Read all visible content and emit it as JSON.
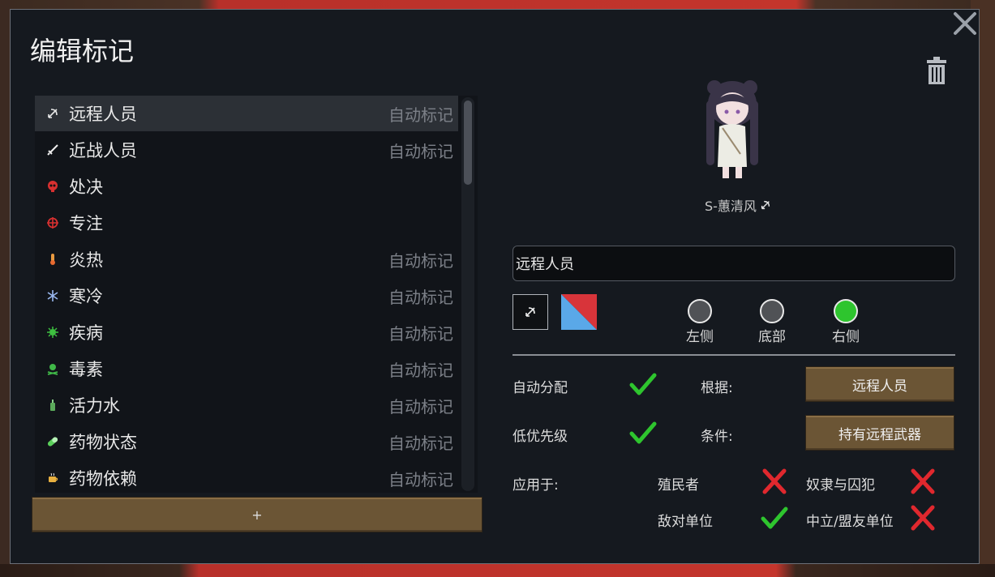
{
  "dialog": {
    "title": "编辑标记",
    "add_label": "+"
  },
  "list": {
    "items": [
      {
        "label": "远程人员",
        "tag": "自动标记",
        "icon": "bow-icon",
        "selected": true
      },
      {
        "label": "近战人员",
        "tag": "自动标记",
        "icon": "sword-icon"
      },
      {
        "label": "处决",
        "tag": "",
        "icon": "skull-icon"
      },
      {
        "label": "专注",
        "tag": "",
        "icon": "crosshair-icon"
      },
      {
        "label": "炎热",
        "tag": "自动标记",
        "icon": "thermometer-icon"
      },
      {
        "label": "寒冷",
        "tag": "自动标记",
        "icon": "snowflake-icon"
      },
      {
        "label": "疾病",
        "tag": "自动标记",
        "icon": "germ-icon"
      },
      {
        "label": "毒素",
        "tag": "自动标记",
        "icon": "poison-icon"
      },
      {
        "label": "活力水",
        "tag": "自动标记",
        "icon": "bottle-icon"
      },
      {
        "label": "药物状态",
        "tag": "自动标记",
        "icon": "pill-icon"
      },
      {
        "label": "药物依赖",
        "tag": "自动标记",
        "icon": "cup-icon"
      }
    ]
  },
  "pawn": {
    "name": "S-蕙清风"
  },
  "editor": {
    "name_value": "远程人员",
    "colors": [
      "#d8343a",
      "#5aa8e8"
    ],
    "positions": [
      {
        "label": "左侧",
        "selected": false
      },
      {
        "label": "底部",
        "selected": false
      },
      {
        "label": "右侧",
        "selected": true
      }
    ],
    "auto_assign_label": "自动分配",
    "auto_assign": true,
    "low_priority_label": "低优先级",
    "low_priority": true,
    "basis_label": "根据:",
    "basis_value": "远程人员",
    "condition_label": "条件:",
    "condition_value": "持有远程武器",
    "apply_label": "应用于:",
    "apply": [
      {
        "label": "殖民者",
        "value": false
      },
      {
        "label": "奴隶与囚犯",
        "value": false
      },
      {
        "label": "敌对单位",
        "value": true
      },
      {
        "label": "中立/盟友单位",
        "value": false
      }
    ]
  },
  "colors": {
    "check": "#2ec52e",
    "cross": "#e0282e",
    "button": "#6b5535"
  }
}
